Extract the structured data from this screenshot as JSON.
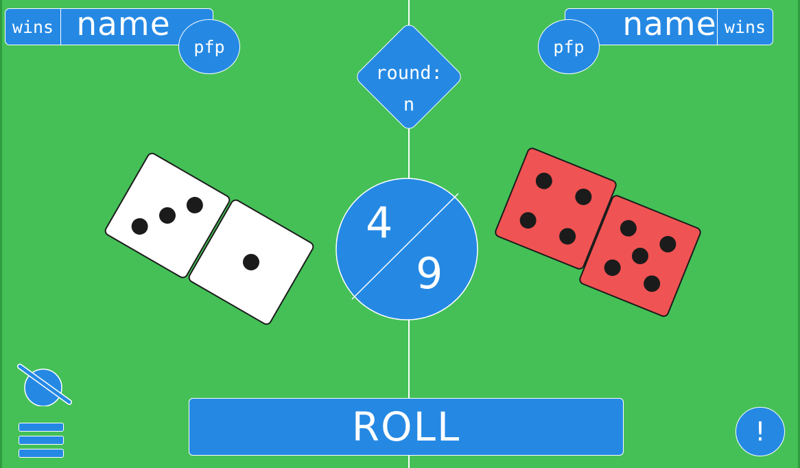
{
  "left_player": {
    "wins_label": "wins",
    "name": "name",
    "pfp_label": "pfp"
  },
  "right_player": {
    "wins_label": "wins",
    "name": "name",
    "pfp_label": "pfp"
  },
  "round": {
    "label": "round:",
    "value": "n"
  },
  "score": {
    "top": "4",
    "bottom": "9"
  },
  "dice": {
    "left": [
      {
        "color": "white",
        "value": 3
      },
      {
        "color": "white",
        "value": 1
      }
    ],
    "right": [
      {
        "color": "red",
        "value": 4
      },
      {
        "color": "red",
        "value": 5
      }
    ]
  },
  "buttons": {
    "roll_label": "ROLL",
    "alert_label": "!"
  },
  "icons": {
    "mute": "muted-circle-icon",
    "menu": "hamburger-menu-icon"
  },
  "colors": {
    "table": "#44c057",
    "ui_blue": "#2589e4",
    "red_die": "#f05353",
    "white_die": "#ffffff",
    "pip": "#1b1b1b"
  }
}
